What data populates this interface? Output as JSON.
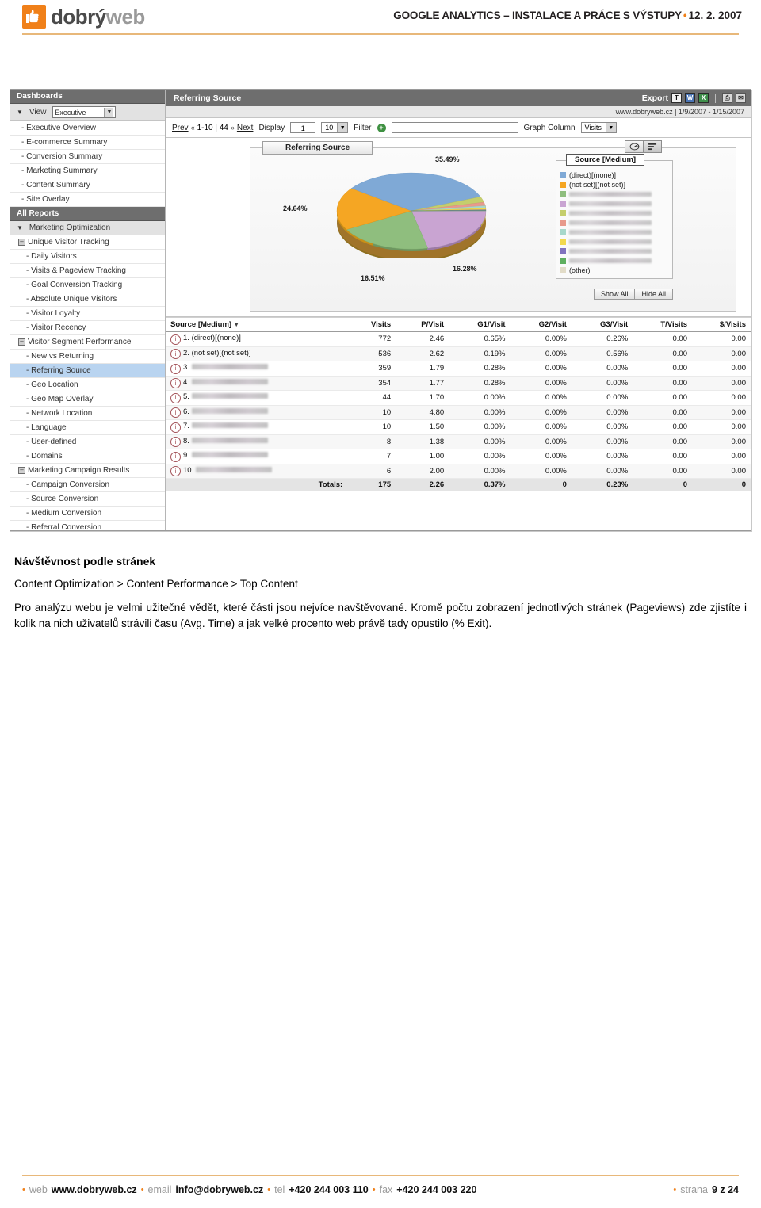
{
  "header": {
    "logo_name_dark": "dobrý",
    "logo_name_light": "web",
    "title": "GOOGLE ANALYTICS – INSTALACE A PRÁCE S VÝSTUPY",
    "bullet": "•",
    "date": "12. 2. 2007",
    "accent_color": "#F08019",
    "rule_color": "#E8B87A"
  },
  "screenshot": {
    "sidebar": {
      "dashboards_header": "Dashboards",
      "view_label": "View",
      "view_value": "Executive",
      "dashboard_items": [
        "- Executive Overview",
        "- E-commerce Summary",
        "- Conversion Summary",
        "- Marketing Summary",
        "- Content Summary",
        "- Site Overlay"
      ],
      "all_reports_header": "All Reports",
      "marketing_optimization": "Marketing Optimization",
      "groups": [
        {
          "name": "Unique Visitor Tracking",
          "items": [
            "- Daily Visitors",
            "- Visits & Pageview Tracking",
            "- Goal Conversion Tracking",
            "- Absolute Unique Visitors",
            "- Visitor Loyalty",
            "- Visitor Recency"
          ]
        },
        {
          "name": "Visitor Segment Performance",
          "items": [
            "- New vs Returning",
            "- Referring Source",
            "- Geo Location",
            "- Geo Map Overlay",
            "- Network Location",
            "- Language",
            "- User-defined",
            "- Domains"
          ],
          "selected": "- Referring Source"
        },
        {
          "name": "Marketing Campaign Results",
          "items": [
            "- Campaign Conversion",
            "- Source Conversion",
            "- Medium Conversion",
            "- Referral Conversion"
          ]
        }
      ]
    },
    "titlebar": {
      "title": "Referring Source",
      "export_label": "Export",
      "export_formats": [
        "T",
        "W",
        "X"
      ],
      "print_icon": "printer-icon",
      "email_icon": "email-icon"
    },
    "urlbar": "www.dobryweb.cz  |  1/9/2007 - 1/15/2007",
    "toolbar": {
      "prev": "Prev",
      "range": "1-10 | 44",
      "next": "Next",
      "display_label": "Display",
      "display_start": "1",
      "display_count": "10",
      "filter_label": "Filter",
      "filter_value": "",
      "graph_column_label": "Graph Column",
      "graph_column_value": "Visits"
    },
    "chart": {
      "tab_title": "Referring Source",
      "legend_title": "Source [Medium]",
      "show_all": "Show All",
      "hide_all": "Hide All",
      "pie_toggle_icon": "pie-chart-icon",
      "bar_toggle_icon": "bar-chart-icon"
    },
    "table": {
      "columns": [
        "Source [Medium]",
        "Visits",
        "P/Visit",
        "G1/Visit",
        "G2/Visit",
        "G3/Visit",
        "T/Visits",
        "$/Visits"
      ],
      "rows": [
        {
          "n": "1.",
          "source": "(direct)[(none)]",
          "redacted": false,
          "visits": "772",
          "pvisit": "2.46",
          "g1": "0.65%",
          "g2": "0.00%",
          "g3": "0.26%",
          "t": "0.00",
          "d": "0.00"
        },
        {
          "n": "2.",
          "source": "(not set)[(not set)]",
          "redacted": false,
          "visits": "536",
          "pvisit": "2.62",
          "g1": "0.19%",
          "g2": "0.00%",
          "g3": "0.56%",
          "t": "0.00",
          "d": "0.00"
        },
        {
          "n": "3.",
          "source": "",
          "redacted": true,
          "visits": "359",
          "pvisit": "1.79",
          "g1": "0.28%",
          "g2": "0.00%",
          "g3": "0.00%",
          "t": "0.00",
          "d": "0.00"
        },
        {
          "n": "4.",
          "source": "",
          "redacted": true,
          "visits": "354",
          "pvisit": "1.77",
          "g1": "0.28%",
          "g2": "0.00%",
          "g3": "0.00%",
          "t": "0.00",
          "d": "0.00"
        },
        {
          "n": "5.",
          "source": "",
          "redacted": true,
          "visits": "44",
          "pvisit": "1.70",
          "g1": "0.00%",
          "g2": "0.00%",
          "g3": "0.00%",
          "t": "0.00",
          "d": "0.00"
        },
        {
          "n": "6.",
          "source": "",
          "redacted": true,
          "visits": "10",
          "pvisit": "4.80",
          "g1": "0.00%",
          "g2": "0.00%",
          "g3": "0.00%",
          "t": "0.00",
          "d": "0.00"
        },
        {
          "n": "7.",
          "source": "",
          "redacted": true,
          "visits": "10",
          "pvisit": "1.50",
          "g1": "0.00%",
          "g2": "0.00%",
          "g3": "0.00%",
          "t": "0.00",
          "d": "0.00"
        },
        {
          "n": "8.",
          "source": "",
          "redacted": true,
          "visits": "8",
          "pvisit": "1.38",
          "g1": "0.00%",
          "g2": "0.00%",
          "g3": "0.00%",
          "t": "0.00",
          "d": "0.00"
        },
        {
          "n": "9.",
          "source": "",
          "redacted": true,
          "visits": "7",
          "pvisit": "1.00",
          "g1": "0.00%",
          "g2": "0.00%",
          "g3": "0.00%",
          "t": "0.00",
          "d": "0.00"
        },
        {
          "n": "10.",
          "source": "",
          "redacted": true,
          "visits": "6",
          "pvisit": "2.00",
          "g1": "0.00%",
          "g2": "0.00%",
          "g3": "0.00%",
          "t": "0.00",
          "d": "0.00"
        }
      ],
      "totals": {
        "label": "Totals:",
        "visits": "175",
        "pvisit": "2.26",
        "g1": "0.37%",
        "g2": "0",
        "g3": "0.23%",
        "t": "0",
        "d": "0"
      }
    }
  },
  "chart_data": {
    "type": "pie",
    "title": "Referring Source",
    "legend_title": "Source [Medium]",
    "legend_position": "right",
    "labels": [
      "(direct)[(none)]",
      "(not set)[(not set)]",
      "",
      "",
      "",
      "",
      "",
      "",
      "",
      "",
      "(other)"
    ],
    "values": [
      35.49,
      24.64,
      16.51,
      16.28,
      2.2,
      1.6,
      1.2,
      0.9,
      0.6,
      0.4,
      0.2
    ],
    "value_labels": [
      "35.49%",
      "24.64%",
      "16.51%",
      "16.28%"
    ],
    "colors": [
      "#7FA9D6",
      "#F5A623",
      "#8FBE7E",
      "#C9A4D2",
      "#C5CE6C",
      "#E89A8C",
      "#A8D8CB",
      "#F2D94E",
      "#8173BE",
      "#5FAF5F",
      "#E2DCC8"
    ],
    "unit": "%"
  },
  "content": {
    "section_title": "Návštěvnost podle stránek",
    "breadcrumb": "Content Optimization > Content Performance > Top Content",
    "paragraph": "Pro analýzu webu je velmi užitečné vědět, které části jsou nejvíce navštěvované. Kromě počtu zobrazení jednotlivých stránek (Pageviews) zde zjistíte i kolik na nich uživatelů strávili času (Avg. Time) a jak velké procento web právě tady opustilo (% Exit)."
  },
  "footer": {
    "bullet": "•",
    "web_label": "web",
    "web_value": "www.dobryweb.cz",
    "email_label": "email",
    "email_value": "info@dobryweb.cz",
    "tel_label": "tel",
    "tel_value": "+420 244 003 110",
    "fax_label": "fax",
    "fax_value": "+420 244 003 220",
    "page_label": "strana",
    "page_value": "9 z 24"
  }
}
